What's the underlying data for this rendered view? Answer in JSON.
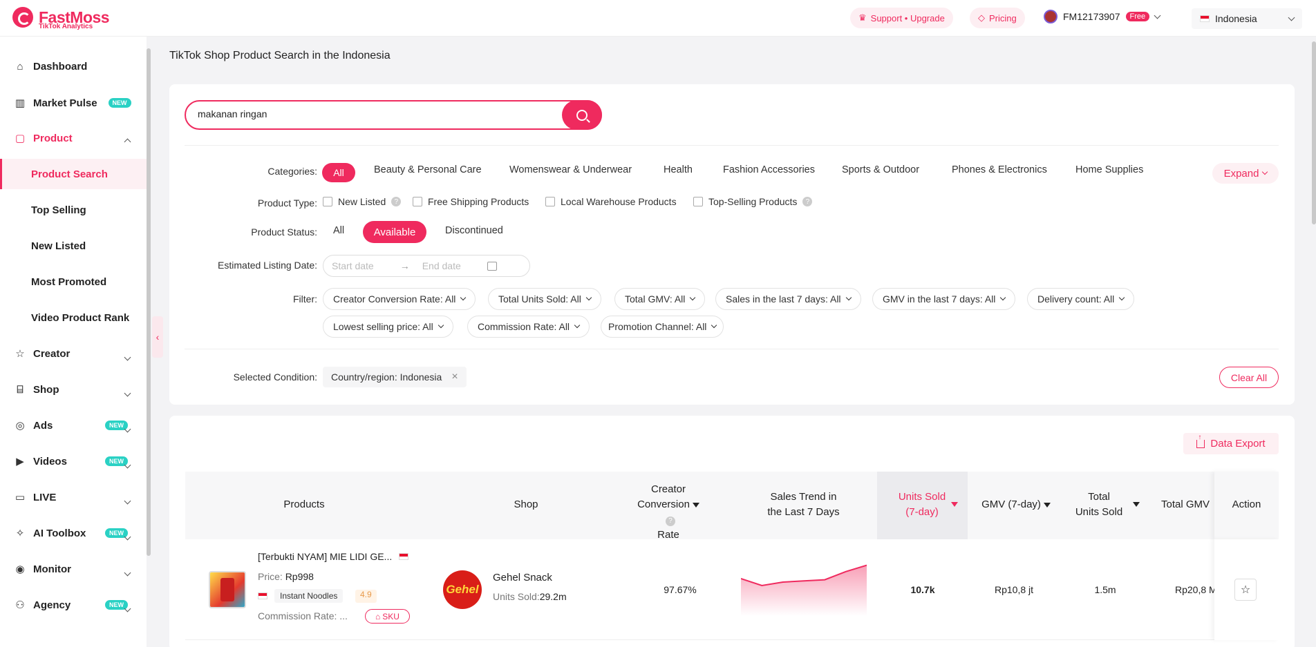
{
  "brand": {
    "name": "FastMoss",
    "tagline": "TikTok Analytics"
  },
  "topbar": {
    "support_label": "Support • Upgrade",
    "pricing_label": "Pricing",
    "user_id": "FM12173907",
    "plan_badge": "Free",
    "country": "Indonesia"
  },
  "sidebar": {
    "items": [
      {
        "label": "Dashboard",
        "icon": "home-icon"
      },
      {
        "label": "Market Pulse",
        "icon": "bar-chart-icon",
        "badge": "NEW"
      },
      {
        "label": "Product",
        "icon": "bag-icon",
        "expanded": true
      },
      {
        "label": "Creator",
        "icon": "star-person-icon"
      },
      {
        "label": "Shop",
        "icon": "shop-icon"
      },
      {
        "label": "Ads",
        "icon": "ads-icon",
        "badge": "NEW"
      },
      {
        "label": "Videos",
        "icon": "video-icon",
        "badge": "NEW"
      },
      {
        "label": "LIVE",
        "icon": "live-icon"
      },
      {
        "label": "AI Toolbox",
        "icon": "ai-icon",
        "badge": "NEW"
      },
      {
        "label": "Monitor",
        "icon": "monitor-icon"
      },
      {
        "label": "Agency",
        "icon": "agency-icon",
        "badge": "NEW"
      }
    ],
    "product_subitems": [
      "Product Search",
      "Top Selling",
      "New Listed",
      "Most Promoted",
      "Video Product Rank"
    ],
    "active_subitem": "Product Search"
  },
  "page": {
    "title": "TikTok Shop Product Search in the Indonesia"
  },
  "search": {
    "value": "makanan ringan"
  },
  "filters": {
    "categories_label": "Categories:",
    "categories": [
      "All",
      "Beauty & Personal Care",
      "Womenswear & Underwear",
      "Health",
      "Fashion Accessories",
      "Sports & Outdoor",
      "Phones & Electronics",
      "Home Supplies"
    ],
    "expand_label": "Expand",
    "product_type_label": "Product Type:",
    "product_types": [
      "New Listed",
      "Free Shipping Products",
      "Local Warehouse Products",
      "Top-Selling Products"
    ],
    "product_status_label": "Product Status:",
    "statuses": [
      "All",
      "Available",
      "Discontinued"
    ],
    "active_status": "Available",
    "listing_date_label": "Estimated Listing Date:",
    "start_placeholder": "Start date",
    "end_placeholder": "End date",
    "filter_label": "Filter:",
    "filter_pills": [
      "Creator Conversion Rate: All",
      "Total Units Sold: All",
      "Total GMV: All",
      "Sales in the last 7 days: All",
      "GMV in the last 7 days: All",
      "Delivery count: All",
      "Lowest selling price: All",
      "Commission Rate: All",
      "Promotion Channel: All"
    ],
    "selected_condition_label": "Selected Condition:",
    "selected_condition": "Country/region: Indonesia",
    "clear_all_label": "Clear All"
  },
  "table": {
    "export_label": "Data Export",
    "headers": {
      "products": "Products",
      "shop": "Shop",
      "creator_conversion_1": "Creator",
      "creator_conversion_2": "Conversion",
      "creator_conversion_3": "Rate",
      "sales_trend_1": "Sales Trend in",
      "sales_trend_2": "the Last 7 Days",
      "units_sold_7d_1": "Units Sold",
      "units_sold_7d_2": "(7-day)",
      "gmv_7d": "GMV (7-day)",
      "total_units_1": "Total",
      "total_units_2": "Units Sold",
      "total_gmv": "Total GMV",
      "action": "Action"
    },
    "rows": [
      {
        "title": "[Terbukti NYAM] MIE LIDI GE...",
        "price_label": "Price:",
        "price": "Rp998",
        "category": "Instant Noodles",
        "rating": "4.9",
        "commission_label": "Commission Rate: ...",
        "sku_label": "SKU",
        "shop_name": "Gehel Snack",
        "shop_logo_text": "Gehel",
        "shop_units_label": "Units Sold:",
        "shop_units": "29.2m",
        "conversion_rate": "97.67%",
        "units_sold_7d": "10.7k",
        "gmv_7d": "Rp10,8 jt",
        "total_units": "1.5m",
        "total_gmv": "Rp20,8 M",
        "trend": [
          0.62,
          0.5,
          0.56,
          0.58,
          0.6,
          0.74,
          0.85
        ],
        "trend_color": "#ef2a5e"
      }
    ]
  }
}
